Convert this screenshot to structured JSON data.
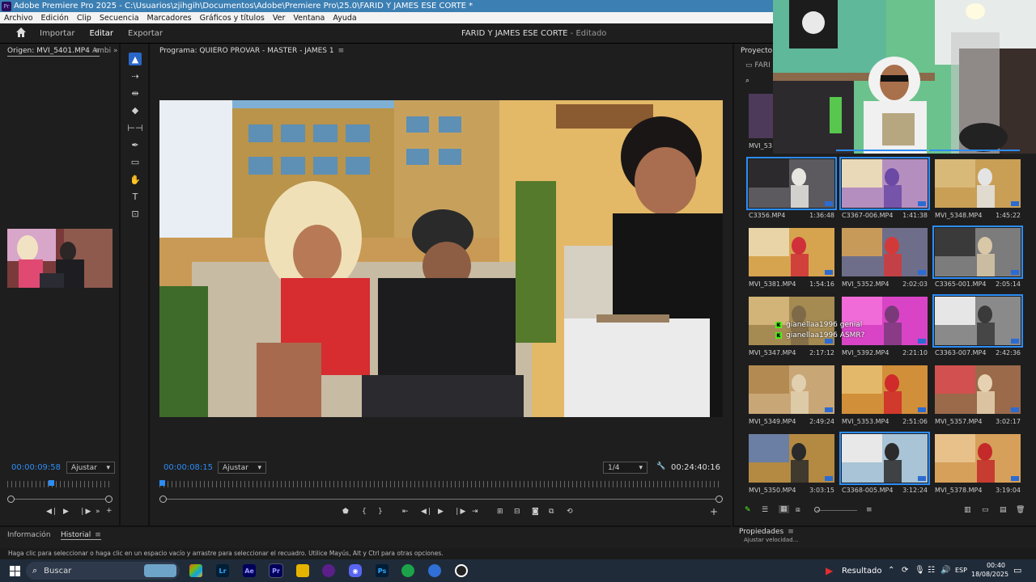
{
  "window": {
    "title": "Adobe Premiere Pro 2025 - C:\\Usuarios\\zjihgih\\Documentos\\Adobe\\Premiere Pro\\25.0\\FARID Y JAMES ESE CORTE *"
  },
  "menu": [
    "Archivo",
    "Edición",
    "Clip",
    "Secuencia",
    "Marcadores",
    "Gráficos y títulos",
    "Ver",
    "Ventana",
    "Ayuda"
  ],
  "header": {
    "import": "Importar",
    "edit": "Editar",
    "export": "Exportar",
    "doc_title": "FARID Y JAMES ESE CORTE",
    "doc_state": " - Editado"
  },
  "source": {
    "tab": "Origen: MVI_5401.MP4",
    "tab2": "Ambi",
    "timecode": "00:00:09:58",
    "fit": "Ajustar"
  },
  "program": {
    "tab": "Programa: QUIERO PROVAR - MASTER - JAMES 1",
    "timecode": "00:00:08:15",
    "fit": "Ajustar",
    "res": "1/4",
    "duration": "00:24:40:16"
  },
  "project": {
    "tab": "Proyecto: FA",
    "folder": "FARI",
    "partial_top_left": "MVI_53",
    "clips": [
      {
        "name": "C3356.MP4",
        "dur": "1:36:48",
        "sel": true
      },
      {
        "name": "C3367-006.MP4",
        "dur": "1:41:38",
        "sel": true
      },
      {
        "name": "MVI_5348.MP4",
        "dur": "1:45:22",
        "sel": false
      },
      {
        "name": "MVI_5381.MP4",
        "dur": "1:54:16",
        "sel": false
      },
      {
        "name": "MVI_5352.MP4",
        "dur": "2:02:03",
        "sel": false
      },
      {
        "name": "C3365-001.MP4",
        "dur": "2:05:14",
        "sel": true
      },
      {
        "name": "MVI_5347.MP4",
        "dur": "2:17:12",
        "sel": false
      },
      {
        "name": "MVI_5392.MP4",
        "dur": "2:21:10",
        "sel": false
      },
      {
        "name": "C3363-007.MP4",
        "dur": "2:42:36",
        "sel": true
      },
      {
        "name": "MVI_5349.MP4",
        "dur": "2:49:24",
        "sel": false
      },
      {
        "name": "MVI_5353.MP4",
        "dur": "2:51:06",
        "sel": false
      },
      {
        "name": "MVI_5357.MP4",
        "dur": "3:02:17",
        "sel": false
      },
      {
        "name": "MVI_5350.MP4",
        "dur": "3:03:15",
        "sel": false
      },
      {
        "name": "C3368-005.MP4",
        "dur": "3:12:24",
        "sel": true
      },
      {
        "name": "MVI_5378.MP4",
        "dur": "3:19:04",
        "sel": false
      }
    ]
  },
  "chat": [
    {
      "user": "gianellaa1996",
      "msg": "genial"
    },
    {
      "user": "gianellaa1996",
      "msg": "ASMR?"
    }
  ],
  "bottom": {
    "info": "Información",
    "history": "Historial",
    "props": "Propiedades",
    "props_item": "Ajustar velocidad..."
  },
  "status": "Haga clic para seleccionar o haga clic en un espacio vacío y arrastre para seleccionar el recuadro. Utilice Mayús, Alt y Ctrl para otras opciones.",
  "taskbar": {
    "search": "Buscar",
    "result": "Resultado",
    "lang": "ESP",
    "time": "00:40",
    "date": "18/08/2025"
  },
  "colors": {
    "accent": "#2c8df7",
    "titlebar": "#3c7fb3",
    "tool_sel": "#2a67c9"
  }
}
